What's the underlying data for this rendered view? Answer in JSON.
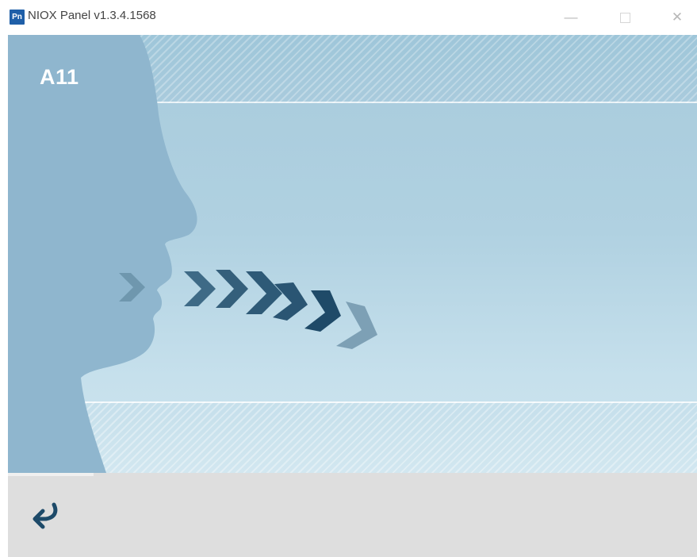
{
  "window": {
    "icon_text": "Pn",
    "title": "NIOX Panel v1.3.4.1568",
    "controls": [
      "minimize-icon",
      "maximize-icon",
      "close-icon"
    ]
  },
  "screen": {
    "label": "A11",
    "illustration": "exhale-profile-with-chevrons"
  },
  "footer": {
    "back_icon": "back-arrow-icon"
  },
  "colors": {
    "background": "#a8cbdc",
    "face": "#8fb6ce",
    "arrow_dark": "#2a5875",
    "arrow_mid": "#3e6a86",
    "arrow_light": "#6f97ae",
    "footer": "#dedede",
    "back_icon": "#1d4a69"
  }
}
